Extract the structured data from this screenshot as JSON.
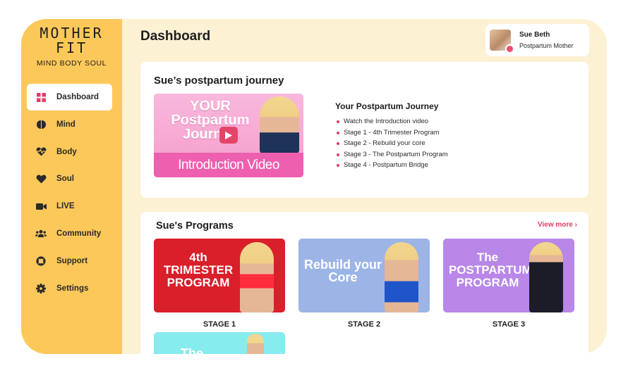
{
  "brand": {
    "logo_line1": "MOTHER",
    "logo_line2": "FIT",
    "tagline": "MIND BODY SOUL"
  },
  "sidebar": {
    "items": [
      {
        "label": "Dashboard",
        "icon": "grid-icon",
        "active": true
      },
      {
        "label": "Mind",
        "icon": "brain-icon"
      },
      {
        "label": "Body",
        "icon": "heartbeat-icon"
      },
      {
        "label": "Soul",
        "icon": "heart-icon"
      },
      {
        "label": "LIVE",
        "icon": "video-camera-icon"
      },
      {
        "label": "Community",
        "icon": "users-icon"
      },
      {
        "label": "Support",
        "icon": "lifebuoy-icon"
      },
      {
        "label": "Settings",
        "icon": "gear-icon"
      }
    ]
  },
  "header": {
    "title": "Dashboard"
  },
  "user": {
    "name": "Sue Beth",
    "role": "Postpartum Mother"
  },
  "journey": {
    "title": "Sue’s postpartum journey",
    "video_overlay": "YOUR Postpartum Journey",
    "video_caption": "Introduction Video",
    "steps_title": "Your Postpartum Journey",
    "steps": [
      "Watch the Introduction video",
      "Stage 1 - 4th Trimester Program",
      "Stage 2 - Rebuild your core",
      "Stage 3 - The Postpartum Program",
      "Stage 4 - Postpartum Bridge"
    ]
  },
  "programs": {
    "title": "Sue's Programs",
    "view_more": "View more",
    "items": [
      {
        "thumb_text": "4th TRIMESTER PROGRAM",
        "stage": "STAGE 1",
        "color": "#d81f2a"
      },
      {
        "thumb_text": "Rebuild your Core",
        "stage": "STAGE 2",
        "color": "#9cb5e6"
      },
      {
        "thumb_text": "The POSTPARTUM PROGRAM",
        "stage": "STAGE 3",
        "color": "#b887e8"
      }
    ],
    "partial_thumb_text": "The"
  },
  "colors": {
    "sidebar": "#fcc85a",
    "background": "#fdf1d4",
    "accent": "#e23d66"
  }
}
